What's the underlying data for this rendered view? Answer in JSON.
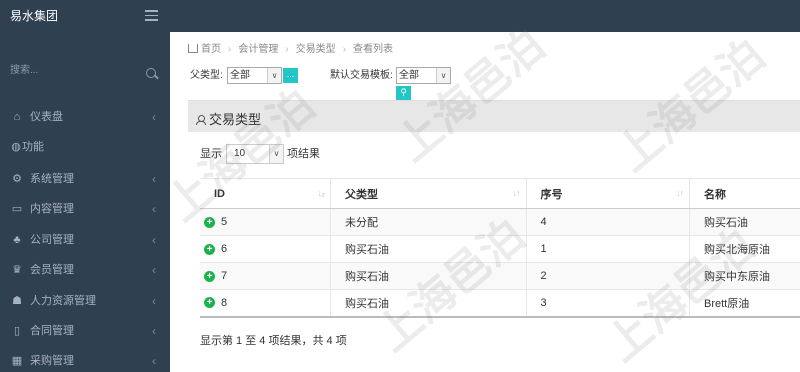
{
  "brand": "易水集团",
  "sidebar": {
    "search_placeholder": "搜索...",
    "items": [
      {
        "label": "仪表盘",
        "icon": "home-icon",
        "glyph": "⌂",
        "chev": "‹"
      },
      {
        "label": "功能",
        "icon": "globe-icon",
        "glyph": "◍",
        "chev": ""
      },
      {
        "label": "系统管理",
        "icon": "cogs-icon",
        "glyph": "⚙",
        "chev": "‹"
      },
      {
        "label": "内容管理",
        "icon": "keyboard-icon",
        "glyph": "▭",
        "chev": "‹"
      },
      {
        "label": "公司管理",
        "icon": "sitemap-icon",
        "glyph": "♣",
        "chev": "‹"
      },
      {
        "label": "会员管理",
        "icon": "trophy-icon",
        "glyph": "♛",
        "chev": "‹"
      },
      {
        "label": "人力资源管理",
        "icon": "users-icon",
        "glyph": "☗",
        "chev": "‹"
      },
      {
        "label": "合同管理",
        "icon": "file-icon",
        "glyph": "▯",
        "chev": "‹"
      },
      {
        "label": "采购管理",
        "icon": "table-icon",
        "glyph": "▦",
        "chev": "‹"
      }
    ]
  },
  "breadcrumb": {
    "items": [
      "首页",
      "会计管理",
      "交易类型",
      "查看列表"
    ],
    "sep": "›"
  },
  "filters": {
    "parent_type_label": "父类型:",
    "parent_type_value": "全部",
    "default_template_label": "默认交易模板:",
    "default_template_value": "全部",
    "more_button": "...",
    "search_button": "⚲"
  },
  "panel": {
    "title": "交易类型"
  },
  "table_controls": {
    "show_label": "显示",
    "page_length": "10",
    "suffix": "项结果",
    "arrow": "∨"
  },
  "table": {
    "columns": [
      {
        "label": "ID",
        "sort": "↓₂"
      },
      {
        "label": "父类型",
        "sort": "↓↑"
      },
      {
        "label": "序号",
        "sort": "↓↑"
      },
      {
        "label": "名称",
        "sort": ""
      }
    ],
    "rows": [
      {
        "id": "5",
        "parent": "未分配",
        "seq": "4",
        "name": "购买石油"
      },
      {
        "id": "6",
        "parent": "购买石油",
        "seq": "1",
        "name": "购买北海原油"
      },
      {
        "id": "7",
        "parent": "购买石油",
        "seq": "2",
        "name": "购买中东原油"
      },
      {
        "id": "8",
        "parent": "购买石油",
        "seq": "3",
        "name": "Brett原油"
      }
    ],
    "expand_glyph": "+"
  },
  "info": "显示第 1 至 4 项结果，共 4 项",
  "watermark": "上海邑泊",
  "colors": {
    "sidebar": "#2f4050",
    "accent": "#23c6c8",
    "expand": "#1ab34d"
  }
}
